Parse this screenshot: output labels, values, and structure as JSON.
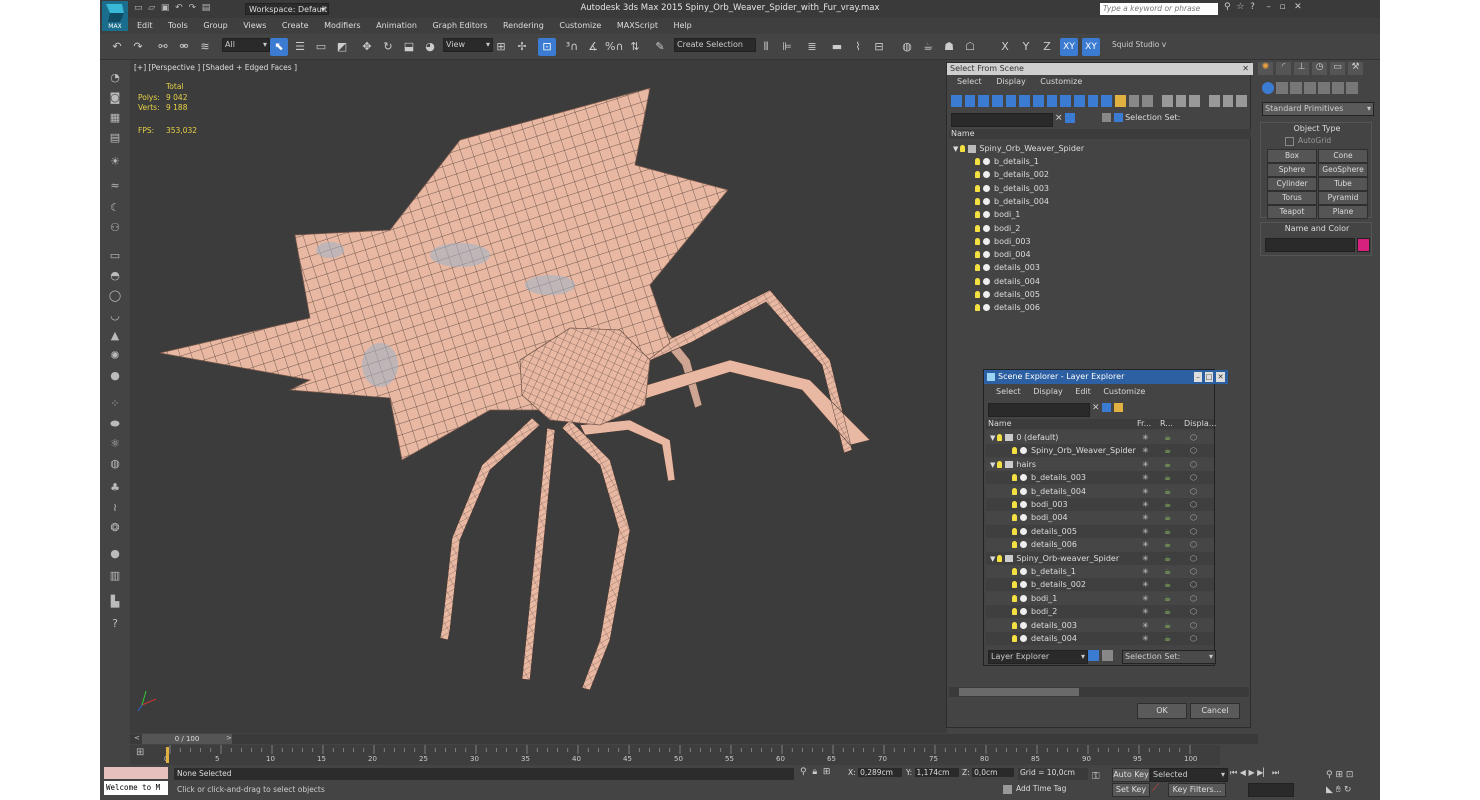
{
  "app": {
    "title": "Autodesk 3ds Max  2015     Spiny_Orb_Weaver_Spider_with_Fur_vray.max",
    "logo": "MAX",
    "workspace": "Workspace: Default",
    "search_placeholder": "Type a keyword or phrase"
  },
  "menu": [
    "Edit",
    "Tools",
    "Group",
    "Views",
    "Create",
    "Modifiers",
    "Animation",
    "Graph Editors",
    "Rendering",
    "Customize",
    "MAXScript",
    "Help"
  ],
  "toolbar": {
    "filter": "All",
    "view": "View",
    "selection_set": "Create Selection Se",
    "axis": [
      "X",
      "Y",
      "Z",
      "XY",
      "XY"
    ],
    "studio": "Squid Studio v"
  },
  "viewport": {
    "label": "[+] [Perspective ] [Shaded + Edged Faces ]",
    "stats": {
      "total_label": "Total",
      "polys_label": "Polys:",
      "polys": "9 042",
      "verts_label": "Verts:",
      "verts": "9 188",
      "fps_label": "FPS:",
      "fps": "353,032"
    }
  },
  "select_from_scene": {
    "title": "Select From Scene",
    "menu": [
      "Select",
      "Display",
      "Customize"
    ],
    "selection_set_label": "Selection Set:",
    "column_name": "Name",
    "root": "Spiny_Orb_Weaver_Spider",
    "items": [
      "b_details_1",
      "b_details_002",
      "b_details_003",
      "b_details_004",
      "bodi_1",
      "bodi_2",
      "bodi_003",
      "bodi_004",
      "details_003",
      "details_004",
      "details_005",
      "details_006"
    ],
    "ok": "OK",
    "cancel": "Cancel"
  },
  "layer_explorer": {
    "title": "Scene Explorer - Layer Explorer",
    "menu": [
      "Select",
      "Display",
      "Edit",
      "Customize"
    ],
    "columns": [
      "Name",
      "Fr...",
      "R...",
      "Displa..."
    ],
    "rows": [
      {
        "label": "0 (default)",
        "level": 0,
        "type": "layer"
      },
      {
        "label": "Spiny_Orb_Weaver_Spider",
        "level": 1,
        "type": "object"
      },
      {
        "label": "hairs",
        "level": 0,
        "type": "layer"
      },
      {
        "label": "b_details_003",
        "level": 1,
        "type": "object"
      },
      {
        "label": "b_details_004",
        "level": 1,
        "type": "object"
      },
      {
        "label": "bodi_003",
        "level": 1,
        "type": "object"
      },
      {
        "label": "bodi_004",
        "level": 1,
        "type": "object"
      },
      {
        "label": "details_005",
        "level": 1,
        "type": "object"
      },
      {
        "label": "details_006",
        "level": 1,
        "type": "object"
      },
      {
        "label": "Spiny_Orb-weaver_Spider",
        "level": 0,
        "type": "layer"
      },
      {
        "label": "b_details_1",
        "level": 1,
        "type": "object"
      },
      {
        "label": "b_details_002",
        "level": 1,
        "type": "object"
      },
      {
        "label": "bodi_1",
        "level": 1,
        "type": "object"
      },
      {
        "label": "bodi_2",
        "level": 1,
        "type": "object"
      },
      {
        "label": "details_003",
        "level": 1,
        "type": "object"
      },
      {
        "label": "details_004",
        "level": 1,
        "type": "object"
      }
    ],
    "footer_dropdown": "Layer Explorer",
    "selection_set_label": "Selection Set:"
  },
  "command_panel": {
    "dropdown": "Standard Primitives",
    "object_type_title": "Object Type",
    "autogrid": "AutoGrid",
    "buttons": [
      "Box",
      "Cone",
      "Sphere",
      "GeoSphere",
      "Cylinder",
      "Tube",
      "Torus",
      "Pyramid",
      "Teapot",
      "Plane"
    ],
    "name_color_title": "Name and Color",
    "color": "#d6217e"
  },
  "timeline": {
    "frame": "0 / 100",
    "ticks": [
      "0",
      "5",
      "10",
      "15",
      "20",
      "25",
      "30",
      "35",
      "40",
      "45",
      "50",
      "55",
      "60",
      "65",
      "70",
      "75",
      "80",
      "85",
      "90",
      "95",
      "100"
    ]
  },
  "status": {
    "maxscript": "Welcome to M",
    "selection": "None Selected",
    "prompt": "Click or click-and-drag to select objects",
    "x_label": "X:",
    "x": "0,289cm",
    "y_label": "Y:",
    "y": "1,174cm",
    "z_label": "Z:",
    "z": "0,0cm",
    "grid": "Grid = 10,0cm",
    "add_time_tag": "Add Time Tag",
    "auto_key": "Auto Key",
    "set_key": "Set Key",
    "selected": "Selected",
    "key_filters": "Key Filters..."
  }
}
